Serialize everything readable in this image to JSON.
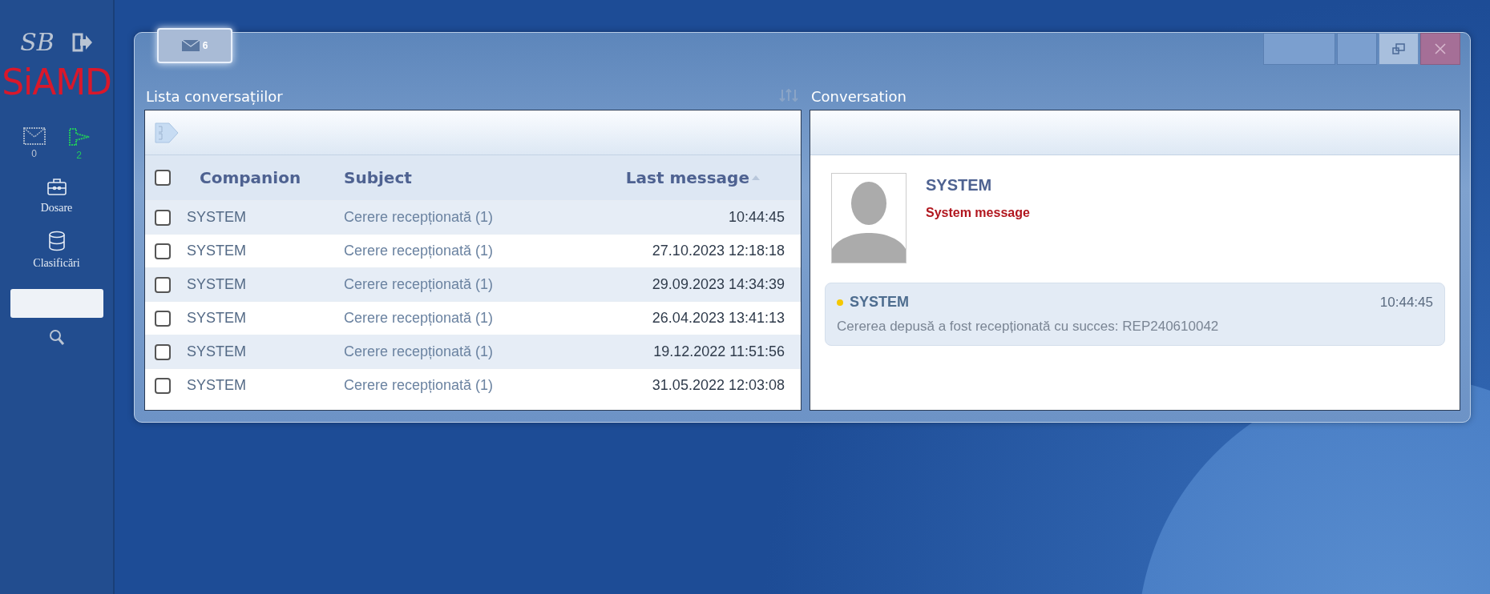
{
  "sidebar": {
    "logo_small": "SB",
    "logo": "SiAMD",
    "counters": [
      {
        "kind": "mail",
        "count": "0"
      },
      {
        "kind": "queue",
        "count": "2"
      }
    ],
    "items": [
      {
        "kind": "briefcase",
        "label": "Dosare"
      },
      {
        "kind": "database",
        "label": "Clasificări"
      }
    ],
    "search": {
      "kind": "field"
    }
  },
  "window": {
    "tab": {
      "count": "6",
      "selected": true
    },
    "list": {
      "title": "Lista conversațiilor",
      "all_checked": false,
      "columns": [
        {
          "label": "Companion",
          "sorted": false
        },
        {
          "label": "Subject",
          "sorted": false
        },
        {
          "label": "Last message",
          "sorted": true
        }
      ],
      "rows": [
        {
          "companion": "SYSTEM",
          "subject": "Cerere recepționată (1)",
          "time": "10:44:45",
          "checked": false
        },
        {
          "companion": "SYSTEM",
          "subject": "Cerere recepționată (1)",
          "time": "27.10.2023 12:18:18",
          "checked": false
        },
        {
          "companion": "SYSTEM",
          "subject": "Cerere recepționată (1)",
          "time": "29.09.2023 14:34:39",
          "checked": false
        },
        {
          "companion": "SYSTEM",
          "subject": "Cerere recepționată (1)",
          "time": "26.04.2023 13:41:13",
          "checked": false
        },
        {
          "companion": "SYSTEM",
          "subject": "Cerere recepționată (1)",
          "time": "19.12.2022 11:51:56",
          "checked": false
        },
        {
          "companion": "SYSTEM",
          "subject": "Cerere recepționată (1)",
          "time": "31.05.2022 12:03:08",
          "checked": false
        }
      ]
    },
    "conversation": {
      "title": "Conversation",
      "name": "SYSTEM",
      "role": "System message",
      "messages": [
        {
          "sender": "SYSTEM",
          "time": "10:44:45",
          "text": "Cererea depusă a fost recepționată cu succes: REP240610042",
          "color": "#f5c800"
        }
      ]
    }
  }
}
